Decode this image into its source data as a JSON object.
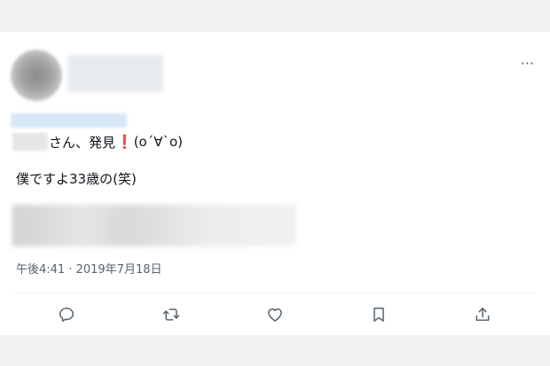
{
  "tweet": {
    "line1_text": "さん、発見",
    "line1_exclamation": "❗",
    "line1_kaomoji": "(o´∀`o)",
    "line2_text": "僕ですよ33歳の(笑)",
    "timestamp": "午後4:41 · 2019年7月18日"
  },
  "header": {
    "more_label": "···"
  },
  "actions": [
    {
      "name": "reply",
      "icon": "speech-bubble-icon"
    },
    {
      "name": "retweet",
      "icon": "retweet-arrows-icon"
    },
    {
      "name": "like",
      "icon": "heart-icon"
    },
    {
      "name": "bookmark",
      "icon": "bookmark-icon"
    },
    {
      "name": "share",
      "icon": "share-upload-icon"
    }
  ],
  "colors": {
    "icon": "#536471",
    "text": "#0f1419",
    "exclamation": "#d91f26"
  }
}
